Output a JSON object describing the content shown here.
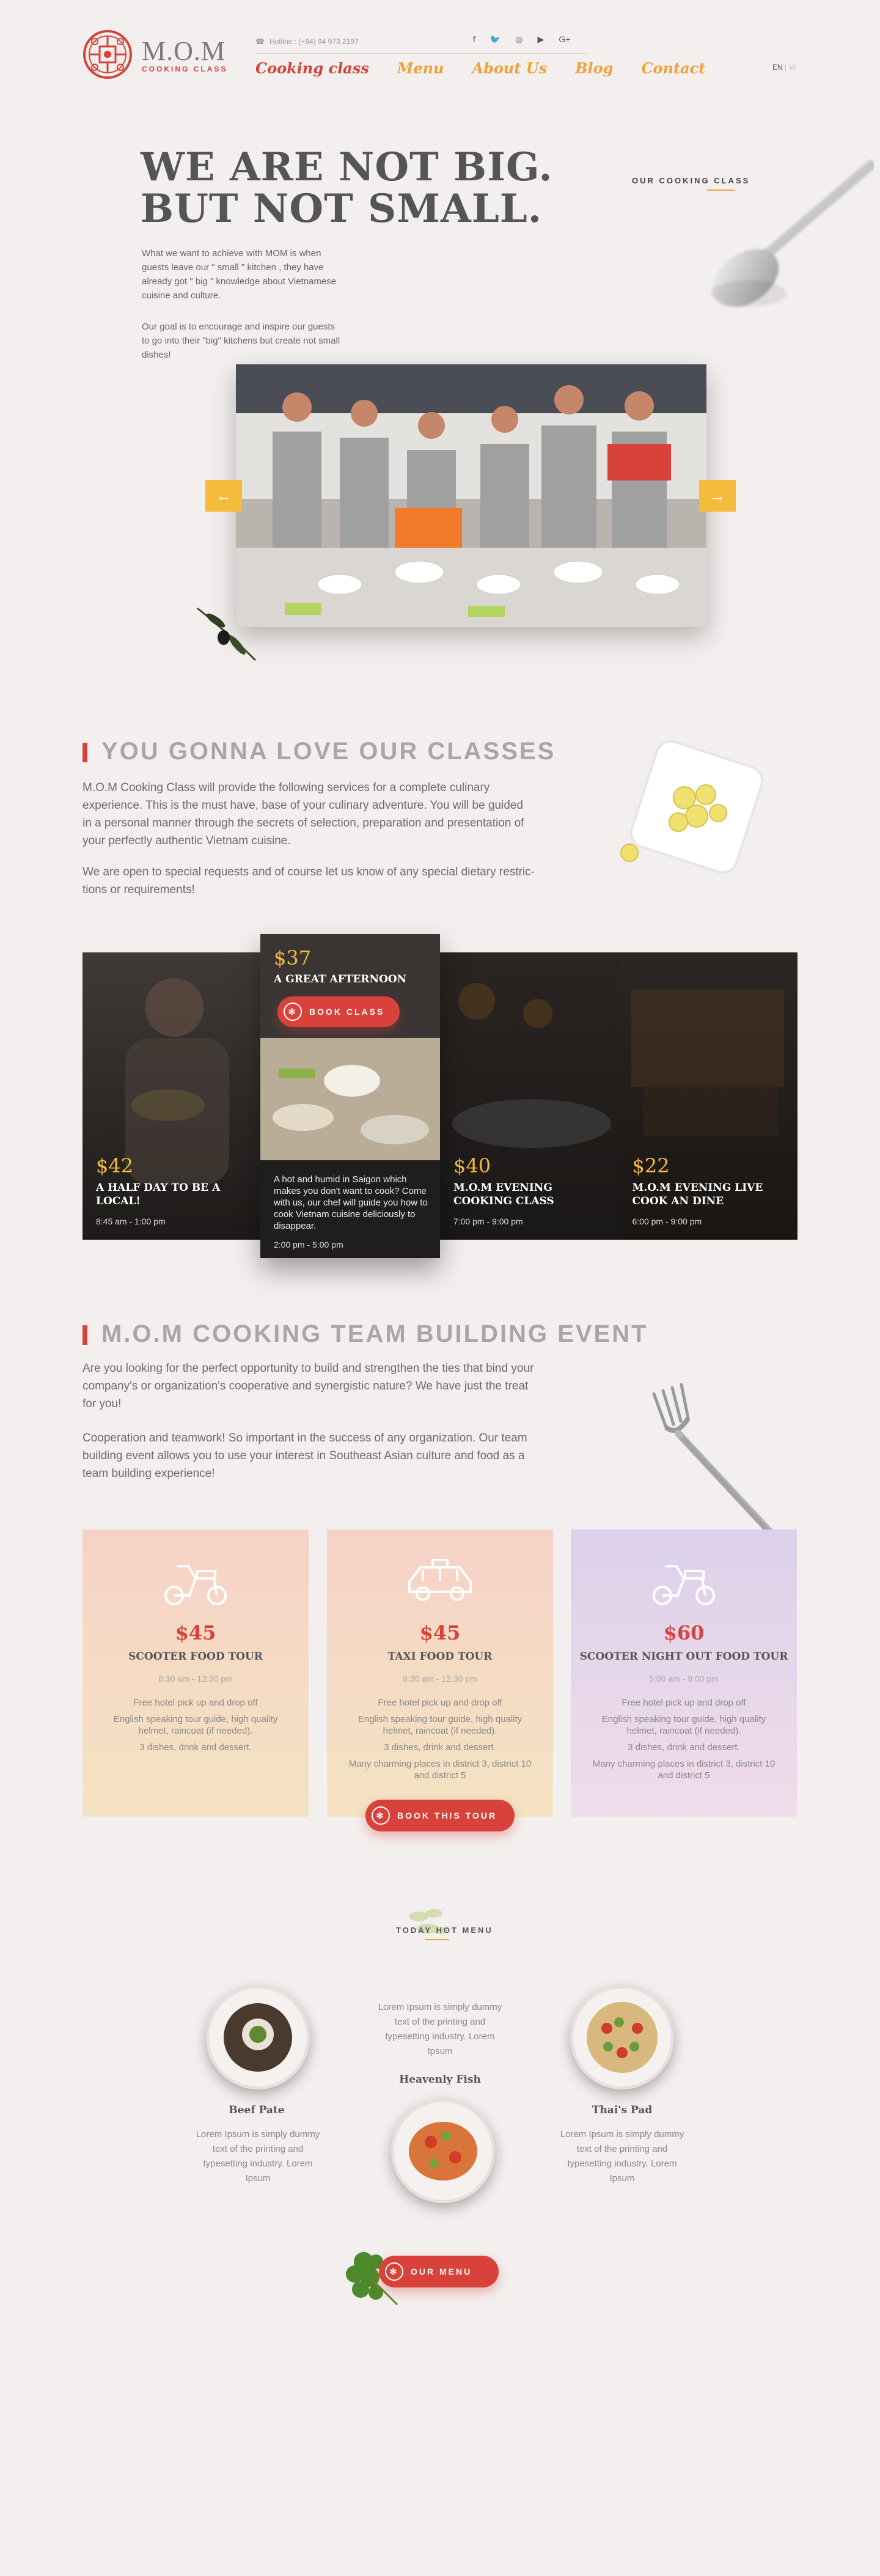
{
  "header": {
    "logo_title": "M.O.M",
    "logo_subtitle": "COOKING CLASS",
    "hotline": "Hotline : (+84) 94 973 2197",
    "socials": [
      "f",
      "t",
      "o",
      "y",
      "G+"
    ],
    "nav": [
      "Cooking class",
      "Menu",
      "About Us",
      "Blog",
      "Contact"
    ],
    "lang_active": "EN",
    "lang_sep": " | ",
    "lang_other": "VI"
  },
  "hero": {
    "title_line1": "WE ARE NOT BIG.",
    "title_line2": "BUT NOT SMALL.",
    "p1": "What we want to achieve with MOM is  when guests leave our \" small \" kitchen , they have already got \" big \" knowledge about Vietnamese cuisine and culture.",
    "p2": "Our goal is to encourage and inspire our guests to go into their \"big\" kitchens but create not small dishes!",
    "side_label": "OUR COOKING CLASS",
    "arrow_left": "←",
    "arrow_right": "→"
  },
  "classes": {
    "title": "YOU GONNA LOVE OUR CLASSES",
    "p1": "M.O.M Cooking Class will provide the following services for a complete culinary experience. This is the must have, base of your culinary adventure. You will be guided in a personal manner through the secrets of selection, preparation and presentation of your perfectly authentic Vietnam cuisine.",
    "p2": "We are open to special requests and of course let us know of any special dietary restric- tions or requirements!",
    "items": [
      {
        "price": "$42",
        "title": "A HALF DAY TO BE A LOCAL!",
        "time": "8:45 am - 1:00 pm"
      },
      {
        "price": "$40",
        "title": "M.O.M EVENING COOKING CLASS",
        "time": "7:00 pm - 9:00 pm"
      },
      {
        "price": "$22",
        "title": "M.O.M EVENING LIVE COOK AN DINE",
        "time": "6:00 pm - 9:00 pm"
      }
    ],
    "featured": {
      "price": "$37",
      "title": "A GREAT AFTERNOON",
      "button": "BOOK CLASS",
      "desc": "A hot and humid in Saigon which makes you don't want to cook? Come with us, our chef will guide you how to cook Vietnam cuisine deliciously to disappear.",
      "time": "2:00 pm - 5:00 pm"
    }
  },
  "team": {
    "title": "M.O.M COOKING TEAM BUILDING EVENT",
    "p1": "Are you looking for the perfect opportunity to build and strengthen the ties that bind your company's or organization's cooperative and synergistic nature? We have just the treat for you!",
    "p2": "Cooperation and teamwork! So important in the success of any organization. Our team building event allows you to use your interest in Southeast Asian culture and food as a team building experience!",
    "button": "BOOK THIS TOUR",
    "tours": [
      {
        "price": "$45",
        "name": "SCOOTER FOOD TOUR",
        "time": "8:30 am - 12:30 pm",
        "lines": [
          "Free hotel pick up and drop off",
          "English speaking tour guide, high quality helmet, raincoat (if needed).",
          "3 dishes, drink and dessert."
        ]
      },
      {
        "price": "$45",
        "name": "TAXI FOOD TOUR",
        "time": "8:30 am - 12:30 pm",
        "lines": [
          "Free hotel pick up and drop off",
          "English speaking tour guide, high quality helmet, raincoat (if needed).",
          "3 dishes, drink and dessert.",
          "Many charming places in district 3, district 10 and district 5"
        ]
      },
      {
        "price": "$60",
        "name": "SCOOTER NIGHT OUT FOOD TOUR",
        "time": "5:00 am - 9:00 pm",
        "lines": [
          "Free hotel pick up and drop off",
          "English speaking tour guide, high quality helmet, raincoat (if needed).",
          "3 dishes, drink and dessert.",
          "Many charming places in district 3, district 10 and district 5"
        ]
      }
    ]
  },
  "menu": {
    "label": "TODAY HOT MENU",
    "lorem": "Lorem Ipsum is simply dummy text of the printing and typesetting industry. Lorem Ipsum",
    "dishes": [
      "Beef Pate",
      "Heavenly Fish",
      "Thai's Pad"
    ],
    "button": "OUR MENU"
  },
  "colors": {
    "accent": "#d8423a",
    "gold": "#f5bb3d",
    "orange": "#f0a13c",
    "bg": "#f3efee"
  }
}
